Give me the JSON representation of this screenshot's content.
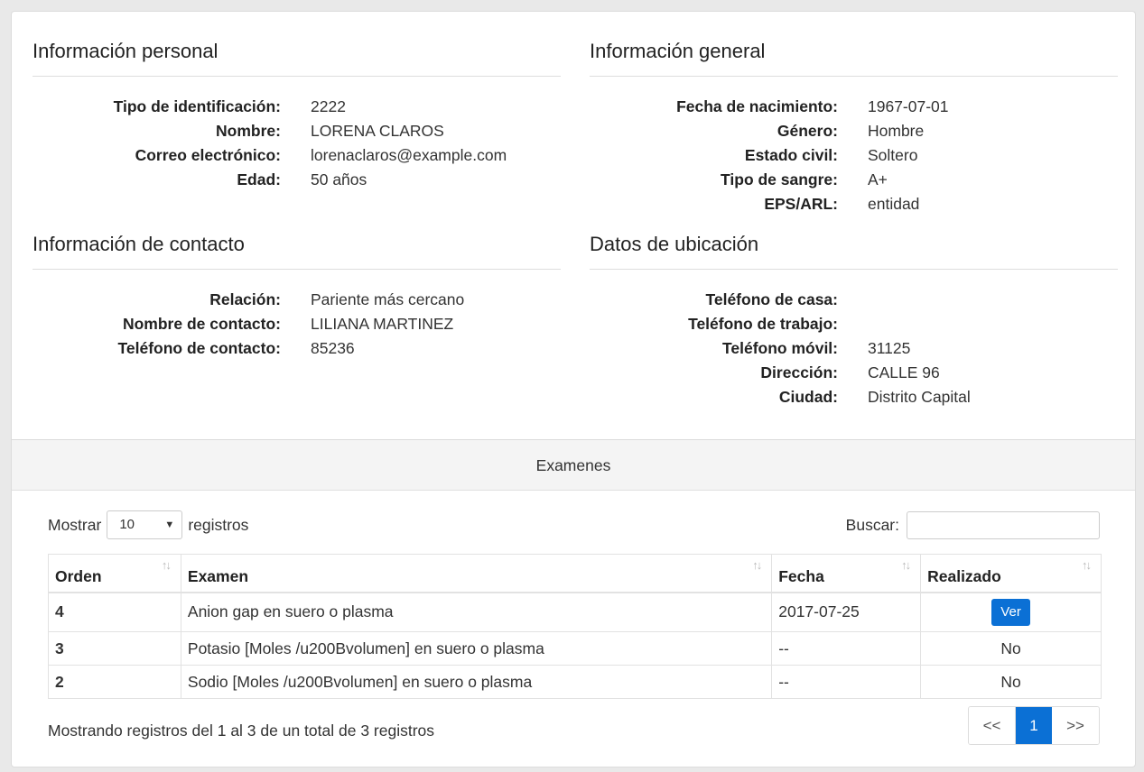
{
  "personal": {
    "title": "Información personal",
    "fields": [
      {
        "label": "Tipo de identificación:",
        "value": "2222"
      },
      {
        "label": "Nombre:",
        "value": "LORENA CLAROS"
      },
      {
        "label": "Correo electrónico:",
        "value": "lorenaclaros@example.com"
      },
      {
        "label": "Edad:",
        "value": "50 años"
      }
    ]
  },
  "general": {
    "title": "Información general",
    "fields": [
      {
        "label": "Fecha de nacimiento:",
        "value": "1967-07-01"
      },
      {
        "label": "Género:",
        "value": "Hombre"
      },
      {
        "label": "Estado civil:",
        "value": "Soltero"
      },
      {
        "label": "Tipo de sangre:",
        "value": "A+"
      },
      {
        "label": "EPS/ARL:",
        "value": "entidad"
      }
    ]
  },
  "contact": {
    "title": "Información de contacto",
    "fields": [
      {
        "label": "Relación:",
        "value": "Pariente más cercano"
      },
      {
        "label": "Nombre de contacto:",
        "value": "LILIANA MARTINEZ"
      },
      {
        "label": "Teléfono de contacto:",
        "value": "85236"
      }
    ]
  },
  "location": {
    "title": "Datos de ubicación",
    "fields": [
      {
        "label": "Teléfono de casa:",
        "value": ""
      },
      {
        "label": "Teléfono de trabajo:",
        "value": ""
      },
      {
        "label": "Teléfono móvil:",
        "value": "31125"
      },
      {
        "label": "Dirección:",
        "value": "CALLE 96"
      },
      {
        "label": "Ciudad:",
        "value": "Distrito Capital"
      }
    ]
  },
  "exams": {
    "header": "Examenes",
    "show_label": "Mostrar",
    "page_size": "10",
    "records_label": "registros",
    "search_label": "Buscar:",
    "search_value": "",
    "columns": [
      "Orden",
      "Examen",
      "Fecha",
      "Realizado"
    ],
    "rows": [
      {
        "orden": "4",
        "examen": "Anion gap en suero o plasma",
        "fecha": "2017-07-25",
        "realizado": "Ver"
      },
      {
        "orden": "3",
        "examen": "Potasio [Moles /u200Bvolumen] en suero o plasma",
        "fecha": "--",
        "realizado": "No"
      },
      {
        "orden": "2",
        "examen": "Sodio [Moles /u200Bvolumen] en suero o plasma",
        "fecha": "--",
        "realizado": "No"
      }
    ],
    "info": "Mostrando registros del 1 al 3 de un total de 3 registros",
    "pagination": {
      "prev": "<<",
      "current": "1",
      "next": ">>"
    }
  },
  "colors": {
    "primary": "#0b70d5",
    "header_bg": "#f4f4f4",
    "page_bg": "#e9e9e9"
  }
}
